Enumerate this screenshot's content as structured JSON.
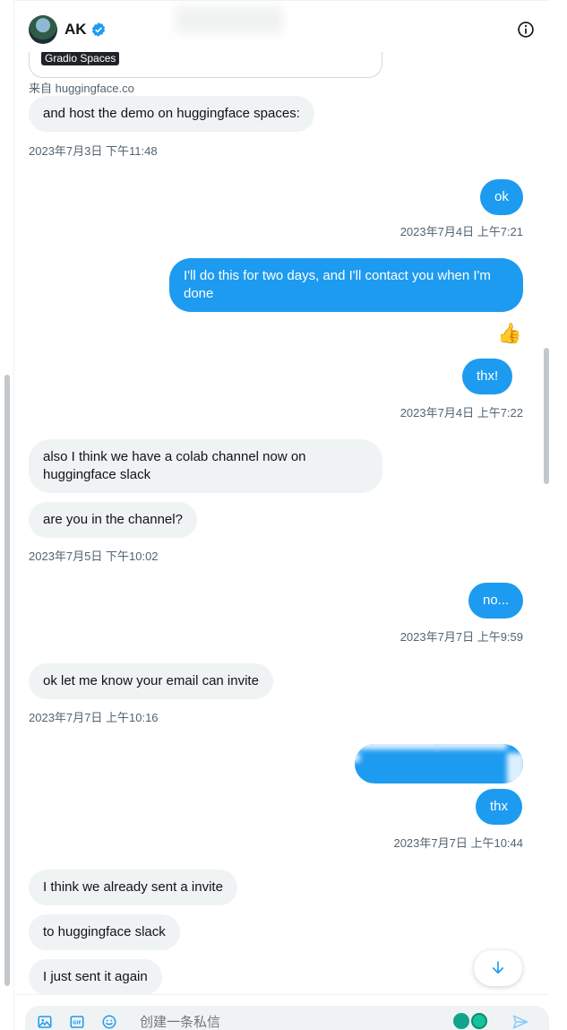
{
  "header": {
    "name": "AK",
    "verified": true,
    "info_icon": "info-icon"
  },
  "link_card": {
    "label": "Gradio Spaces",
    "source": "来自 huggingface.co"
  },
  "messages": [
    {
      "side": "in",
      "text": "and host the demo on huggingface spaces:"
    },
    {
      "time": "2023年7月3日 下午11:48"
    },
    {
      "side": "out",
      "text": "ok"
    },
    {
      "time": "2023年7月4日 上午7:21"
    },
    {
      "side": "out",
      "text": "I'll do this for two days, and I'll contact you when I'm done",
      "reaction": "👍"
    },
    {
      "side": "out",
      "text": "thx!"
    },
    {
      "time": "2023年7月4日 上午7:22"
    },
    {
      "side": "in",
      "text": "also I think we have a colab channel now on huggingface slack"
    },
    {
      "side": "in",
      "text": "are you in the channel?"
    },
    {
      "time": "2023年7月5日 下午10:02"
    },
    {
      "side": "out",
      "text": "no..."
    },
    {
      "time": "2023年7月7日 上午9:59"
    },
    {
      "side": "in",
      "text": "ok let me know your email can invite"
    },
    {
      "time": "2023年7月7日 上午10:16"
    },
    {
      "side": "out",
      "text": "thx"
    },
    {
      "time": "2023年7月7日 上午10:44"
    },
    {
      "side": "in",
      "text": "I think we already sent a invite"
    },
    {
      "side": "in",
      "text": "to huggingface slack"
    },
    {
      "side": "in",
      "text": "I just sent it again"
    }
  ],
  "composer": {
    "placeholder": "创建一条私信",
    "icons": [
      "image-icon",
      "gif-icon",
      "emoji-icon",
      "send-icon"
    ]
  },
  "colors": {
    "accent": "#1d9bf0",
    "incoming_bubble": "#eff3f4",
    "text_secondary": "#536471"
  }
}
